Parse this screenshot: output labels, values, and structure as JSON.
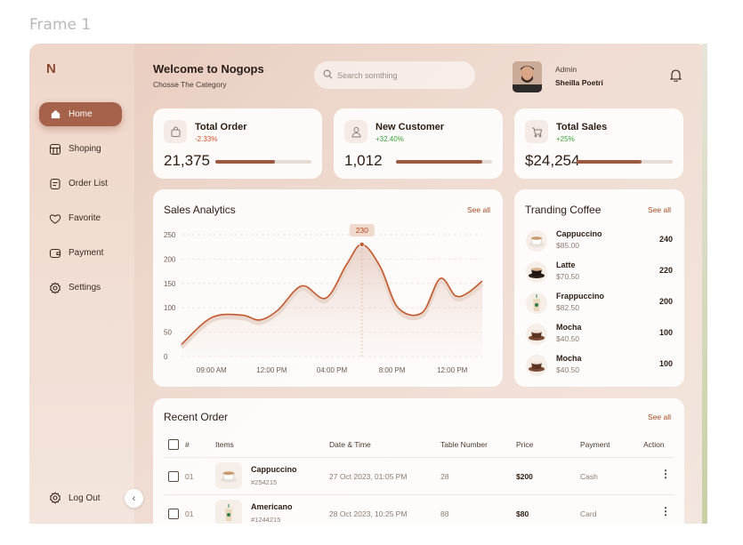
{
  "frame_label": "Frame 1",
  "sidebar": {
    "logo": "N",
    "items": [
      {
        "label": "Home",
        "icon": "home-icon"
      },
      {
        "label": "Shoping",
        "icon": "shop-icon"
      },
      {
        "label": "Order List",
        "icon": "order-list-icon"
      },
      {
        "label": "Favorite",
        "icon": "heart-icon"
      },
      {
        "label": "Payment",
        "icon": "wallet-icon"
      },
      {
        "label": "Settings",
        "icon": "gear-icon"
      }
    ],
    "logout": "Log Out",
    "collapse": "‹"
  },
  "header": {
    "title": "Welcome to Nogops",
    "subtitle": "Chosse The Category",
    "search_placeholder": "Search somthing",
    "user_role": "Admin",
    "user_name": "Sheilla Poetri"
  },
  "stats": [
    {
      "title": "Total Order",
      "change": "-2.33%",
      "value": "21,375",
      "progress": 0.62,
      "change_color": "#d0532a"
    },
    {
      "title": "New Customer",
      "change": "+32.40%",
      "value": "1,012",
      "progress": 0.9,
      "change_color": "#3aa33a"
    },
    {
      "title": "Total Sales",
      "change": "+25%",
      "value": "$24,254",
      "progress": 0.68,
      "change_color": "#3aa33a"
    }
  ],
  "sales": {
    "title": "Sales Analytics",
    "see_all": "See all"
  },
  "chart_data": {
    "type": "area",
    "title": "Sales Analytics",
    "x_ticks": [
      "09:00 AM",
      "12:00 PM",
      "04:00 PM",
      "8:00 PM",
      "12:00 PM"
    ],
    "y_ticks": [
      "250",
      "200",
      "150",
      "100",
      "50",
      "0"
    ],
    "ylim": [
      0,
      250
    ],
    "x": [
      0,
      0.5,
      1,
      1.3,
      1.6,
      2,
      2.4,
      2.75,
      3,
      3.3,
      3.6,
      4,
      4.3,
      4.55,
      4.75,
      5
    ],
    "values": [
      25,
      80,
      85,
      75,
      95,
      145,
      120,
      190,
      230,
      185,
      100,
      90,
      160,
      125,
      130,
      155
    ],
    "peak_label": "230",
    "grid": true,
    "accent": "#c4582b"
  },
  "trending": {
    "title": "Tranding Coffee",
    "see_all": "See all",
    "items": [
      {
        "name": "Cappuccino",
        "price": "$85.00",
        "count": "240"
      },
      {
        "name": "Latte",
        "price": "$70.50",
        "count": "220"
      },
      {
        "name": "Frappuccino",
        "price": "$82.50",
        "count": "200"
      },
      {
        "name": "Mocha",
        "price": "$40.50",
        "count": "100"
      },
      {
        "name": "Mocha",
        "price": "$40.50",
        "count": "100"
      }
    ]
  },
  "orders": {
    "title": "Recent Order",
    "see_all": "See all",
    "columns": [
      "#",
      "Items",
      "Date & Time",
      "Table Number",
      "Price",
      "Payment",
      "Action"
    ],
    "rows": [
      {
        "no": "01",
        "item": "Cappuccino",
        "code": "#254215",
        "date": "27 Oct 2023, 01:05 PM",
        "table": "28",
        "price": "$200",
        "payment": "Cash"
      },
      {
        "no": "01",
        "item": "Americano",
        "code": "#1244215",
        "date": "28 Oct 2023, 10:25 PM",
        "table": "88",
        "price": "$80",
        "payment": "Card"
      }
    ]
  }
}
